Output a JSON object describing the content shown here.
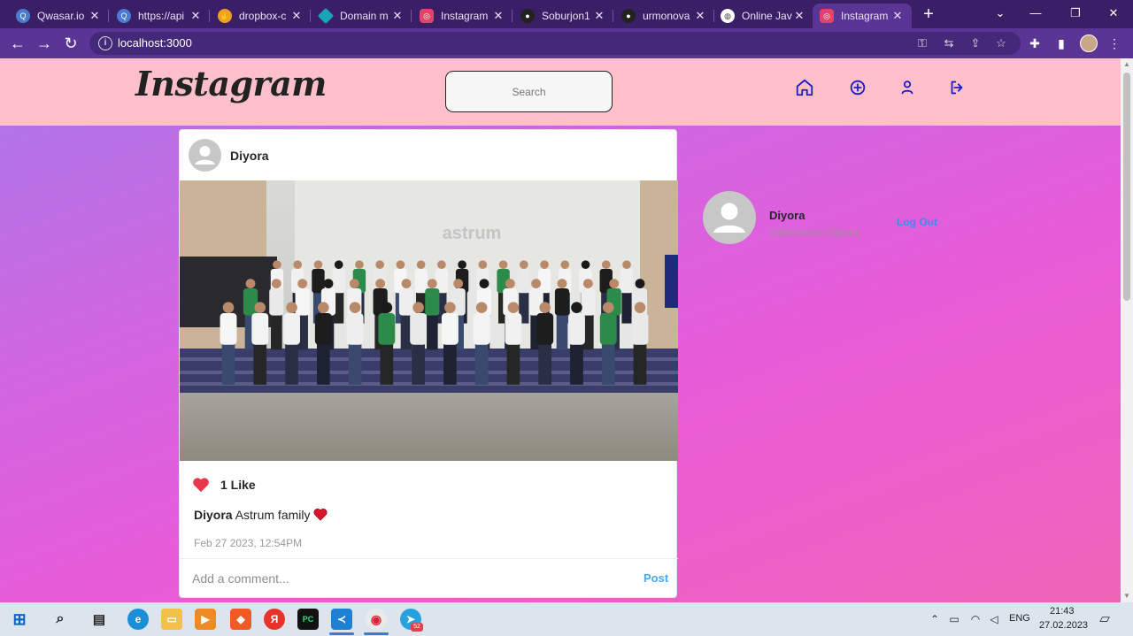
{
  "browser": {
    "tabs": [
      {
        "title": "Qwasar.io",
        "icon": "qwasar-icon",
        "color": "#4a7bd0"
      },
      {
        "title": "https://api",
        "icon": "qwasar-icon",
        "color": "#4a7bd0"
      },
      {
        "title": "dropbox-c",
        "icon": "hand-icon",
        "color": "#f0a020"
      },
      {
        "title": "Domain m",
        "icon": "diamond-icon",
        "color": "#1aa5b5"
      },
      {
        "title": "Instagram",
        "icon": "instagram-icon",
        "color": "#e0446a"
      },
      {
        "title": "Soburjon1",
        "icon": "github-icon",
        "color": "#222222"
      },
      {
        "title": "urmonova",
        "icon": "github-icon",
        "color": "#222222"
      },
      {
        "title": "Online Java",
        "icon": "globe-icon",
        "color": "#444444"
      },
      {
        "title": "Instagram",
        "icon": "instagram-icon",
        "color": "#e0446a"
      }
    ],
    "url": "localhost:3000"
  },
  "header": {
    "logo": "Instagram",
    "search_placeholder": "Search"
  },
  "post": {
    "username": "Diyora",
    "likes": "1 Like",
    "caption_user": "Diyora",
    "caption_text": "Astrum family",
    "date": "Feb 27 2023, 12:54PM",
    "comment_placeholder": "Add a comment...",
    "post_label": "Post",
    "photo_banner": "astrum"
  },
  "sidebar": {
    "username": "Diyora",
    "full_name": "Ormonova Diyora",
    "logout": "Log Out"
  },
  "taskbar": {
    "lang": "ENG",
    "time": "21:43",
    "date": "27.02.2023",
    "telegram_badge": "52"
  },
  "colors": {
    "header_bg": "#ffc0cb",
    "nav_icon": "#1d1dc8",
    "link_blue": "#3a8ef0",
    "like_red": "#e8374a"
  }
}
